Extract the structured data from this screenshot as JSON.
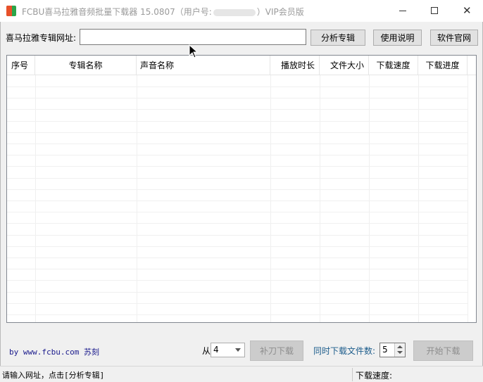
{
  "window": {
    "title_prefix": "FCBU喜马拉雅音频批量下载器 15.0807（用户号:",
    "title_suffix": "）VIP会员版",
    "minimize_glyph": "",
    "close_glyph": "✕"
  },
  "toolbar": {
    "url_label": "喜马拉雅专辑网址:",
    "url_value": "",
    "analyze_label": "分析专辑",
    "help_label": "使用说明",
    "site_label": "软件官网"
  },
  "table": {
    "columns": [
      "序号",
      "专辑名称",
      "声音名称",
      "播放时长",
      "文件大小",
      "下载速度",
      "下载进度"
    ],
    "rows": []
  },
  "footer": {
    "byline": "by www.fcbu.com 苏刻",
    "from_label": "从",
    "from_value": "4",
    "resume_label": "补刀下载",
    "concurrent_label": "同时下载文件数:",
    "concurrent_value": "5",
    "start_label": "开始下载"
  },
  "status": {
    "message": "请输入网址，点击[分析专辑]",
    "speed_label": "下载速度:"
  }
}
